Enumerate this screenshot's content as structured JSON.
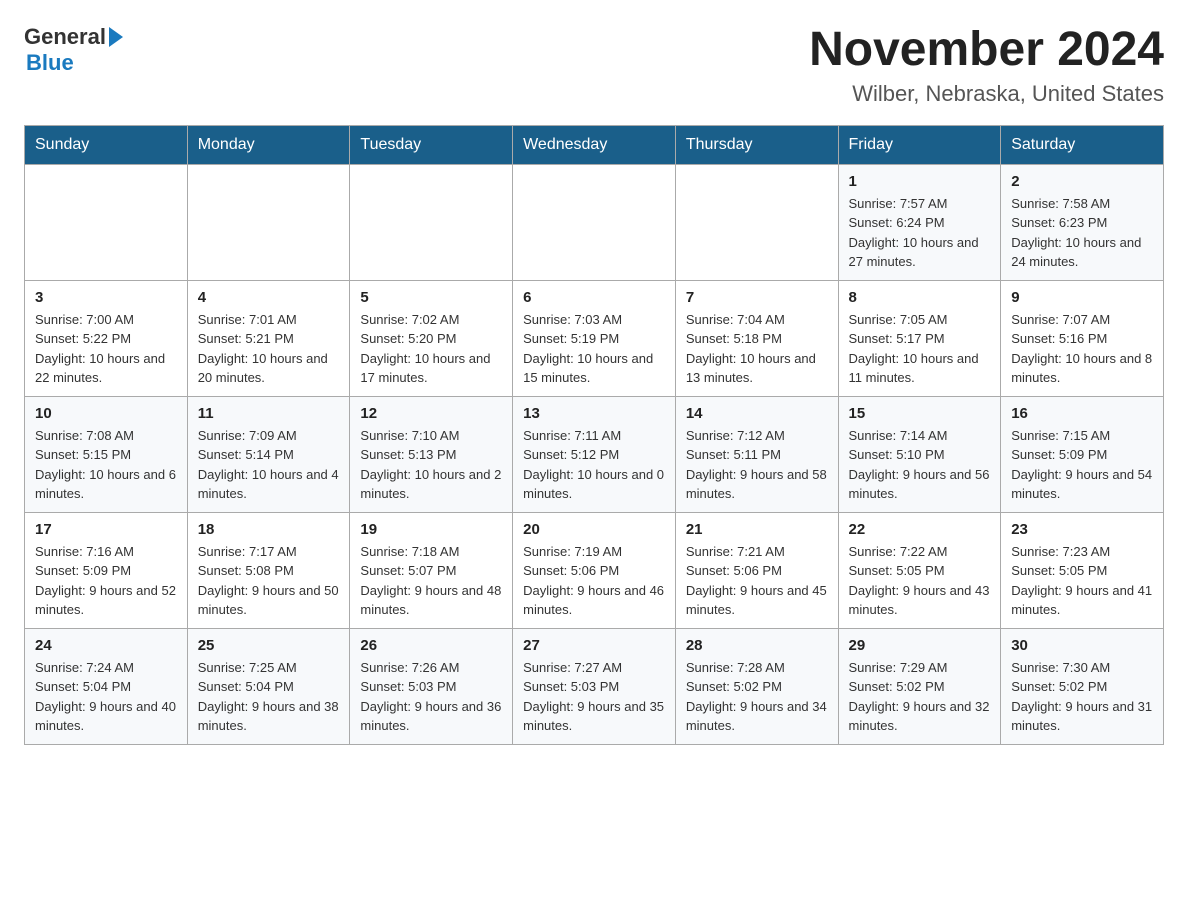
{
  "logo": {
    "general": "General",
    "blue": "Blue"
  },
  "title": "November 2024",
  "subtitle": "Wilber, Nebraska, United States",
  "days_of_week": [
    "Sunday",
    "Monday",
    "Tuesday",
    "Wednesday",
    "Thursday",
    "Friday",
    "Saturday"
  ],
  "weeks": [
    [
      {
        "day": "",
        "info": ""
      },
      {
        "day": "",
        "info": ""
      },
      {
        "day": "",
        "info": ""
      },
      {
        "day": "",
        "info": ""
      },
      {
        "day": "",
        "info": ""
      },
      {
        "day": "1",
        "info": "Sunrise: 7:57 AM\nSunset: 6:24 PM\nDaylight: 10 hours and 27 minutes."
      },
      {
        "day": "2",
        "info": "Sunrise: 7:58 AM\nSunset: 6:23 PM\nDaylight: 10 hours and 24 minutes."
      }
    ],
    [
      {
        "day": "3",
        "info": "Sunrise: 7:00 AM\nSunset: 5:22 PM\nDaylight: 10 hours and 22 minutes."
      },
      {
        "day": "4",
        "info": "Sunrise: 7:01 AM\nSunset: 5:21 PM\nDaylight: 10 hours and 20 minutes."
      },
      {
        "day": "5",
        "info": "Sunrise: 7:02 AM\nSunset: 5:20 PM\nDaylight: 10 hours and 17 minutes."
      },
      {
        "day": "6",
        "info": "Sunrise: 7:03 AM\nSunset: 5:19 PM\nDaylight: 10 hours and 15 minutes."
      },
      {
        "day": "7",
        "info": "Sunrise: 7:04 AM\nSunset: 5:18 PM\nDaylight: 10 hours and 13 minutes."
      },
      {
        "day": "8",
        "info": "Sunrise: 7:05 AM\nSunset: 5:17 PM\nDaylight: 10 hours and 11 minutes."
      },
      {
        "day": "9",
        "info": "Sunrise: 7:07 AM\nSunset: 5:16 PM\nDaylight: 10 hours and 8 minutes."
      }
    ],
    [
      {
        "day": "10",
        "info": "Sunrise: 7:08 AM\nSunset: 5:15 PM\nDaylight: 10 hours and 6 minutes."
      },
      {
        "day": "11",
        "info": "Sunrise: 7:09 AM\nSunset: 5:14 PM\nDaylight: 10 hours and 4 minutes."
      },
      {
        "day": "12",
        "info": "Sunrise: 7:10 AM\nSunset: 5:13 PM\nDaylight: 10 hours and 2 minutes."
      },
      {
        "day": "13",
        "info": "Sunrise: 7:11 AM\nSunset: 5:12 PM\nDaylight: 10 hours and 0 minutes."
      },
      {
        "day": "14",
        "info": "Sunrise: 7:12 AM\nSunset: 5:11 PM\nDaylight: 9 hours and 58 minutes."
      },
      {
        "day": "15",
        "info": "Sunrise: 7:14 AM\nSunset: 5:10 PM\nDaylight: 9 hours and 56 minutes."
      },
      {
        "day": "16",
        "info": "Sunrise: 7:15 AM\nSunset: 5:09 PM\nDaylight: 9 hours and 54 minutes."
      }
    ],
    [
      {
        "day": "17",
        "info": "Sunrise: 7:16 AM\nSunset: 5:09 PM\nDaylight: 9 hours and 52 minutes."
      },
      {
        "day": "18",
        "info": "Sunrise: 7:17 AM\nSunset: 5:08 PM\nDaylight: 9 hours and 50 minutes."
      },
      {
        "day": "19",
        "info": "Sunrise: 7:18 AM\nSunset: 5:07 PM\nDaylight: 9 hours and 48 minutes."
      },
      {
        "day": "20",
        "info": "Sunrise: 7:19 AM\nSunset: 5:06 PM\nDaylight: 9 hours and 46 minutes."
      },
      {
        "day": "21",
        "info": "Sunrise: 7:21 AM\nSunset: 5:06 PM\nDaylight: 9 hours and 45 minutes."
      },
      {
        "day": "22",
        "info": "Sunrise: 7:22 AM\nSunset: 5:05 PM\nDaylight: 9 hours and 43 minutes."
      },
      {
        "day": "23",
        "info": "Sunrise: 7:23 AM\nSunset: 5:05 PM\nDaylight: 9 hours and 41 minutes."
      }
    ],
    [
      {
        "day": "24",
        "info": "Sunrise: 7:24 AM\nSunset: 5:04 PM\nDaylight: 9 hours and 40 minutes."
      },
      {
        "day": "25",
        "info": "Sunrise: 7:25 AM\nSunset: 5:04 PM\nDaylight: 9 hours and 38 minutes."
      },
      {
        "day": "26",
        "info": "Sunrise: 7:26 AM\nSunset: 5:03 PM\nDaylight: 9 hours and 36 minutes."
      },
      {
        "day": "27",
        "info": "Sunrise: 7:27 AM\nSunset: 5:03 PM\nDaylight: 9 hours and 35 minutes."
      },
      {
        "day": "28",
        "info": "Sunrise: 7:28 AM\nSunset: 5:02 PM\nDaylight: 9 hours and 34 minutes."
      },
      {
        "day": "29",
        "info": "Sunrise: 7:29 AM\nSunset: 5:02 PM\nDaylight: 9 hours and 32 minutes."
      },
      {
        "day": "30",
        "info": "Sunrise: 7:30 AM\nSunset: 5:02 PM\nDaylight: 9 hours and 31 minutes."
      }
    ]
  ]
}
